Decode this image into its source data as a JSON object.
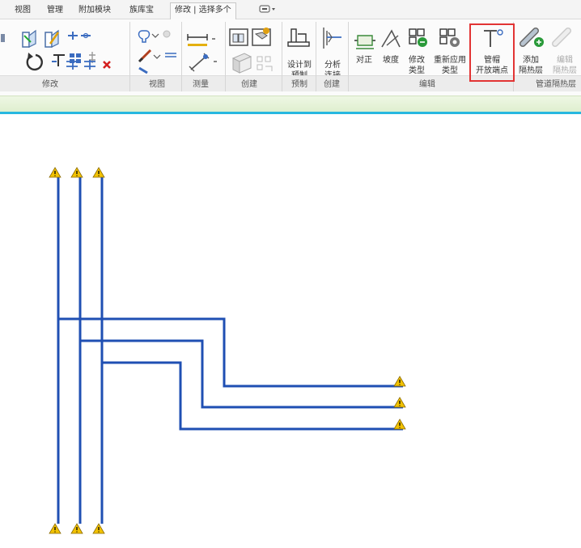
{
  "tabs": [
    {
      "label": "视图"
    },
    {
      "label": "管理"
    },
    {
      "label": "附加模块"
    },
    {
      "label": "族库宝"
    },
    {
      "label": "修改 | 选择多个"
    }
  ],
  "ribbon": {
    "panels": {
      "modify": "修改",
      "view": "视图",
      "measure": "测量",
      "create": "创建",
      "prefab": "预制",
      "create2": "创建",
      "edit": "编辑",
      "insulation": "管道隔热层"
    },
    "buttons": {
      "design_to_prefab": "设计到\n预制",
      "analyze_connection": "分析\n连接",
      "align": "对正",
      "slope": "坡度",
      "modify_type": "修改\n类型",
      "reapply_type": "重新应用\n类型",
      "pipe_cap": "管帽\n开放端点",
      "add_insulation": "添加\n隔热层",
      "edit_insulation": "编辑\n隔热层"
    }
  },
  "drawing": {
    "pipe_color": "#1f4fb3",
    "warning_color": "#f2c200",
    "warning_count": 9
  }
}
